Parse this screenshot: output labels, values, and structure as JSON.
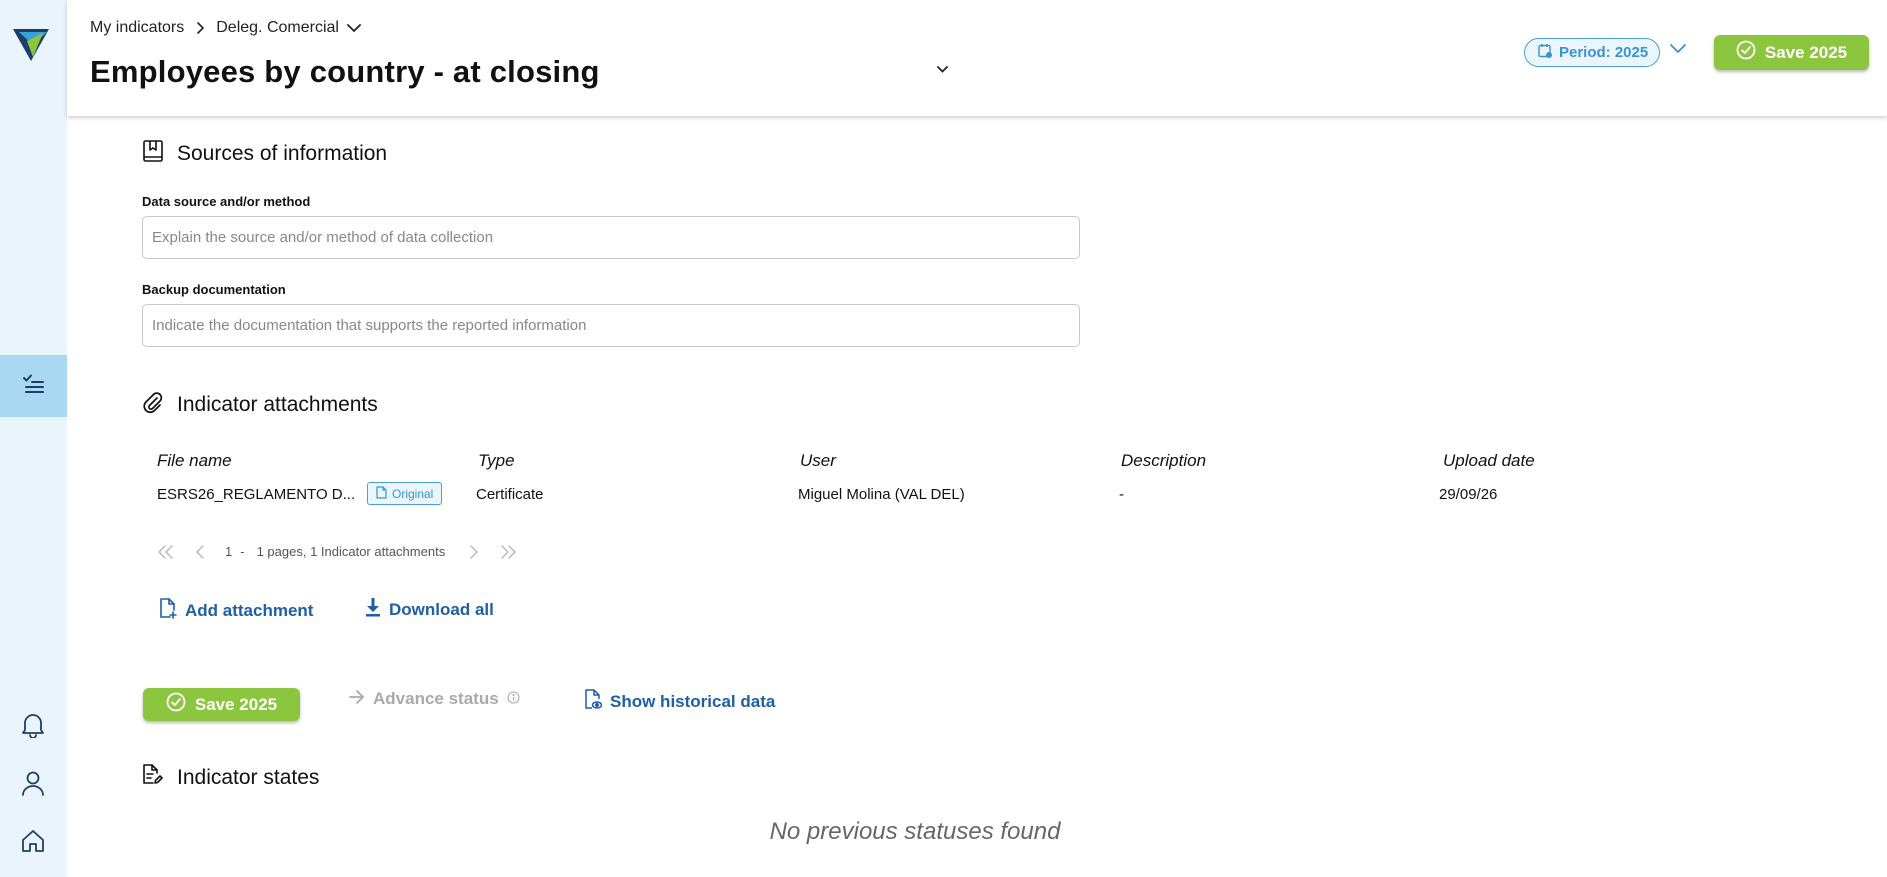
{
  "breadcrumb": {
    "root": "My indicators",
    "current": "Deleg. Comercial"
  },
  "header": {
    "title": "Employees by country - at closing",
    "period_label": "Period: 2025",
    "save_label": "Save 2025"
  },
  "sources": {
    "title": "Sources of information",
    "data_source_label": "Data source and/or method",
    "data_source_placeholder": "Explain the source and/or method of data collection",
    "backup_label": "Backup documentation",
    "backup_placeholder": "Indicate the documentation that supports the reported information"
  },
  "attachments": {
    "title": "Indicator attachments",
    "columns": [
      "File name",
      "Type",
      "User",
      "Description",
      "Upload date"
    ],
    "rows": [
      {
        "file_name": "ESRS26_REGLAMENTO D...",
        "badge": "Original",
        "type": "Certificate",
        "user": "Miguel Molina (VAL DEL)",
        "description": "-",
        "upload_date": "29/09/26"
      }
    ],
    "pagination": {
      "page": "1",
      "dash": "-",
      "summary": "1 pages, 1 Indicator attachments"
    },
    "add_label": "Add attachment",
    "download_label": "Download all"
  },
  "actions": {
    "save_label": "Save 2025",
    "advance_label": "Advance status",
    "historical_label": "Show historical data"
  },
  "states": {
    "title": "Indicator states",
    "empty_message": "No previous statuses found"
  },
  "colors": {
    "accent_green": "#8cc63f",
    "link_blue": "#1f5fa5",
    "pill_blue": "#3b93d0",
    "sidebar_bg": "#e9f4fb",
    "sidebar_active": "#a9d8f2"
  },
  "icons": {
    "logo": "brand-logo",
    "nav_active": "checklist-icon",
    "notifications": "bell-icon",
    "profile": "user-icon",
    "home": "home-icon"
  }
}
